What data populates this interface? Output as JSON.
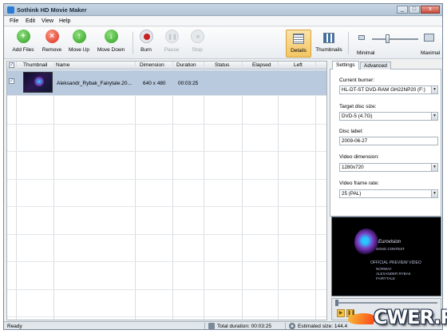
{
  "window": {
    "title": "Sothink HD Movie Maker",
    "minimize": "_",
    "maximize": "□",
    "close": "x"
  },
  "menu": [
    "File",
    "Edit",
    "View",
    "Help"
  ],
  "toolbar": {
    "add_files": "Add Files",
    "remove": "Remove",
    "move_up": "Move Up",
    "move_down": "Move Down",
    "burn": "Burn",
    "pause": "Pause",
    "stop": "Stop",
    "details": "Details",
    "thumbnails": "Thumbnails",
    "minimal": "Minimal",
    "maximal": "Maximal",
    "zoom_level": 0.35
  },
  "grid": {
    "headers": [
      "Thumbnail",
      "Name",
      "Dimension",
      "Duration",
      "Status",
      "Elapsed",
      "Left"
    ],
    "rows": [
      {
        "checked": true,
        "name": "Aleksandr_Rybak_Fairytale.20...",
        "dimension": "640 x 480",
        "duration": "00:03:25",
        "status": "",
        "elapsed": "",
        "left": ""
      }
    ]
  },
  "settings": {
    "tabs": [
      "Settings",
      "Advanced"
    ],
    "current_burner_label": "Current burner:",
    "current_burner": "HL-DT-ST DVD-RAM GH22NP20 (F:)",
    "target_disc_label": "Target disc size:",
    "target_disc": "DVD-5 (4.7G)",
    "disc_label_label": "Disc label:",
    "disc_label": "2009-06-27",
    "video_dimension_label": "Video dimension:",
    "video_dimension": "1280x720",
    "frame_rate_label": "Video frame rate:",
    "frame_rate": "25 (PAL)"
  },
  "preview": {
    "brand": "Eurovision",
    "sub": "SONG CONTEST",
    "caption": "OFFICIAL PREVIEW VIDEO",
    "line1": "NORWAY",
    "line2": "ALEXANDER RYBAK",
    "line3": "FAIRYTALE"
  },
  "status": {
    "ready": "Ready",
    "total_duration": "Total duration: 00:03:25",
    "estimated_size": "Estimated size: 144.4"
  },
  "watermark": "CWER.RU"
}
